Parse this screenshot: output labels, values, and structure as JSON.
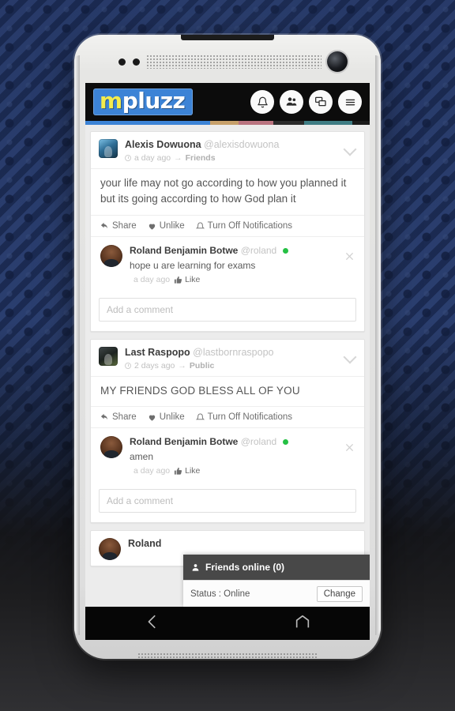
{
  "app": {
    "logo_first": "m",
    "logo_rest": "pluzz",
    "header_icons": [
      {
        "name": "bell-icon",
        "label": "Notifications"
      },
      {
        "name": "people-icon",
        "label": "Friends"
      },
      {
        "name": "chat-bubbles-icon",
        "label": "Messages"
      },
      {
        "name": "hamburger-menu-icon",
        "label": "Menu"
      }
    ],
    "color_strip": [
      "#3c83d6",
      "#c7a06a",
      "#b9737f",
      "#2a2a2a",
      "#3f7d84",
      "#1b1b1b"
    ]
  },
  "posts": [
    {
      "author_name": "Alexis Dowuona",
      "author_handle": "@alexisdowuona",
      "time": "a day ago",
      "separator": "→",
      "audience": "Friends",
      "body": "your life may not go according to how you planned it but its going according to how God plan it",
      "actions": {
        "share": "Share",
        "like": "Unlike",
        "notify": "Turn Off Notifications"
      },
      "comment": {
        "name": "Roland Benjamin Botwe",
        "handle": "@roland",
        "text": "hope u are learning for exams",
        "time": "a day ago",
        "like": "Like"
      },
      "comment_placeholder": "Add a comment"
    },
    {
      "author_name": "Last Raspopo",
      "author_handle": "@lastbornraspopo",
      "time": "2 days ago",
      "separator": "→",
      "audience": "Public",
      "body": "MY FRIENDS GOD BLESS ALL OF YOU",
      "actions": {
        "share": "Share",
        "like": "Unlike",
        "notify": "Turn Off Notifications"
      },
      "comment": {
        "name": "Roland Benjamin Botwe",
        "handle": "@roland",
        "text": "amen",
        "time": "a day ago",
        "like": "Like"
      },
      "comment_placeholder": "Add a comment"
    },
    {
      "author_name": "Roland",
      "author_handle": "",
      "time": "",
      "separator": "",
      "audience": "",
      "body": "",
      "comment_placeholder": ""
    }
  ],
  "chat_dock": {
    "title": "Friends online (0)",
    "status": "Status : Online",
    "change_button": "Change"
  },
  "navbar": {
    "back": "back-icon",
    "home": "home-icon"
  },
  "colors": {
    "accent_blue": "#3c83d6",
    "logo_yellow": "#f4ec4c",
    "online_green": "#25c044",
    "chat_header": "#484848",
    "backdrop_blue": "#2e4376"
  }
}
